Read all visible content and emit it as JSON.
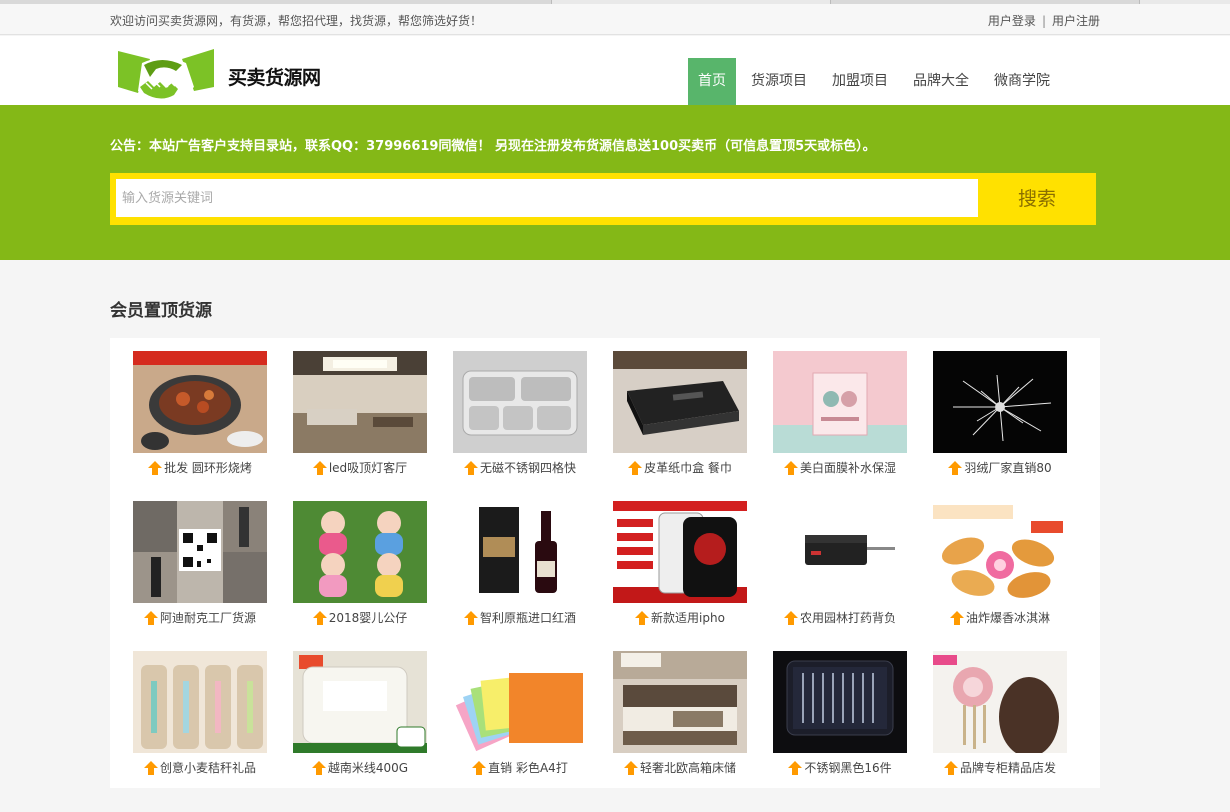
{
  "topbar": {
    "welcome": "欢迎访问买卖货源网，有货源，帮您招代理，找货源，帮您筛选好货！",
    "login": "用户登录",
    "separator": "|",
    "register": "用户注册"
  },
  "logo": {
    "text": "买卖货源网"
  },
  "nav": {
    "items": [
      {
        "label": "首页"
      },
      {
        "label": "货源项目"
      },
      {
        "label": "加盟项目"
      },
      {
        "label": "品牌大全"
      },
      {
        "label": "微商学院"
      }
    ]
  },
  "banner": {
    "notice": "公告：本站广告客户支持目录站，联系QQ：37996619同微信！ 另现在注册发布货源信息送100买卖币（可信息置顶5天或标色）。"
  },
  "search": {
    "placeholder": "输入货源关键词",
    "button": "搜索"
  },
  "section": {
    "title": "会员置顶货源"
  },
  "products": [
    {
      "caption": "批发 圆环形烧烤"
    },
    {
      "caption": "led吸顶灯客厅"
    },
    {
      "caption": "无磁不锈钢四格快"
    },
    {
      "caption": "皮革纸巾盒 餐巾"
    },
    {
      "caption": "美白面膜补水保湿"
    },
    {
      "caption": "羽绒厂家直销80"
    },
    {
      "caption": "阿迪耐克工厂货源"
    },
    {
      "caption": "2018婴儿公仔"
    },
    {
      "caption": "智利原瓶进口红酒"
    },
    {
      "caption": "新款适用ipho"
    },
    {
      "caption": "农用园林打药背负"
    },
    {
      "caption": "油炸爆香冰淇淋"
    },
    {
      "caption": "创意小麦秸秆礼品"
    },
    {
      "caption": "越南米线400G"
    },
    {
      "caption": "直销 彩色A4打"
    },
    {
      "caption": "轻奢北欧高箱床储"
    },
    {
      "caption": "不锈钢黑色16件"
    },
    {
      "caption": "品牌专柜精品店发"
    }
  ],
  "colors": {
    "banner": "#84b817",
    "nav_active": "#58b56b",
    "search_bar": "#ffe100",
    "logo_green": "#7cc226",
    "up_arrow": "#ff9a00"
  }
}
